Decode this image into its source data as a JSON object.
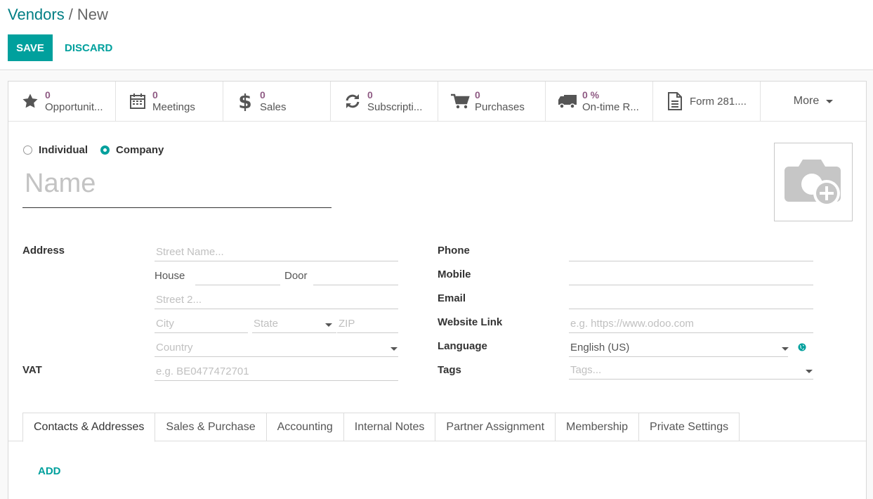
{
  "breadcrumb": {
    "parent": "Vendors",
    "separator": "/",
    "current": "New"
  },
  "actions": {
    "save": "SAVE",
    "discard": "DISCARD"
  },
  "stat_buttons": [
    {
      "icon": "star-icon",
      "value": "0",
      "label": "Opportunit..."
    },
    {
      "icon": "calendar-icon",
      "value": "0",
      "label": "Meetings"
    },
    {
      "icon": "dollar-icon",
      "value": "0",
      "label": "Sales"
    },
    {
      "icon": "refresh-icon",
      "value": "0",
      "label": "Subscripti..."
    },
    {
      "icon": "cart-icon",
      "value": "0",
      "label": "Purchases"
    },
    {
      "icon": "truck-icon",
      "value": "0 %",
      "label": "On-time R..."
    },
    {
      "icon": "document-icon",
      "value": "",
      "label": "Form 281...."
    }
  ],
  "more_label": "More",
  "partner_type": {
    "individual": "Individual",
    "company": "Company",
    "selected": "Company"
  },
  "name_placeholder": "Name",
  "address": {
    "label": "Address",
    "street_placeholder": "Street Name...",
    "house_label": "House",
    "door_label": "Door",
    "street2_placeholder": "Street 2...",
    "city_placeholder": "City",
    "state_placeholder": "State",
    "zip_placeholder": "ZIP",
    "country_placeholder": "Country"
  },
  "vat": {
    "label": "VAT",
    "placeholder": "e.g. BE0477472701"
  },
  "contact": {
    "phone_label": "Phone",
    "mobile_label": "Mobile",
    "email_label": "Email",
    "website_label": "Website Link",
    "website_placeholder": "e.g. https://www.odoo.com",
    "language_label": "Language",
    "language_value": "English (US)",
    "tags_label": "Tags",
    "tags_placeholder": "Tags..."
  },
  "tabs": [
    "Contacts & Addresses",
    "Sales & Purchase",
    "Accounting",
    "Internal Notes",
    "Partner Assignment",
    "Membership",
    "Private Settings"
  ],
  "active_tab": "Contacts & Addresses",
  "add_label": "ADD",
  "colors": {
    "accent": "#00a09d",
    "link": "#017e84",
    "stat_value": "#8f5b84"
  }
}
